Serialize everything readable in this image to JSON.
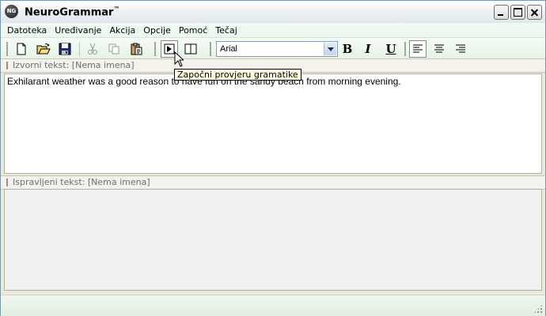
{
  "window": {
    "title": "NeuroGrammar",
    "title_mark": "™",
    "icon_text": "NG"
  },
  "menu": {
    "items": [
      "Datoteka",
      "Uređivanje",
      "Akcija",
      "Opcije",
      "Pomoć",
      "Tečaj"
    ]
  },
  "toolbar": {
    "font_name": "Arial",
    "buttons": [
      "new-file-icon",
      "open-folder-icon",
      "save-disk-icon",
      "cut-icon",
      "copy-icon",
      "paste-icon",
      "play-icon",
      "split-view-icon",
      "bold-icon",
      "italic-icon",
      "underline-icon",
      "align-left-icon",
      "align-center-icon",
      "align-right-icon"
    ],
    "bold_label": "B",
    "italic_label": "I",
    "underline_label": "U"
  },
  "tooltip": {
    "text": "Započni provjeru gramatike"
  },
  "source_pane": {
    "header": "Izvorni tekst: [Nema imena]",
    "text": "Exhilarant weather was a good reason to have fun on the sandy beach from morning evening."
  },
  "corrected_pane": {
    "header": "Ispravljeni tekst: [Nema imena]",
    "text": ""
  },
  "colors": {
    "menu_bg": "#eef8ee",
    "toolbar_bg": "#e6f3e6",
    "tooltip_bg": "#ffffe1"
  }
}
